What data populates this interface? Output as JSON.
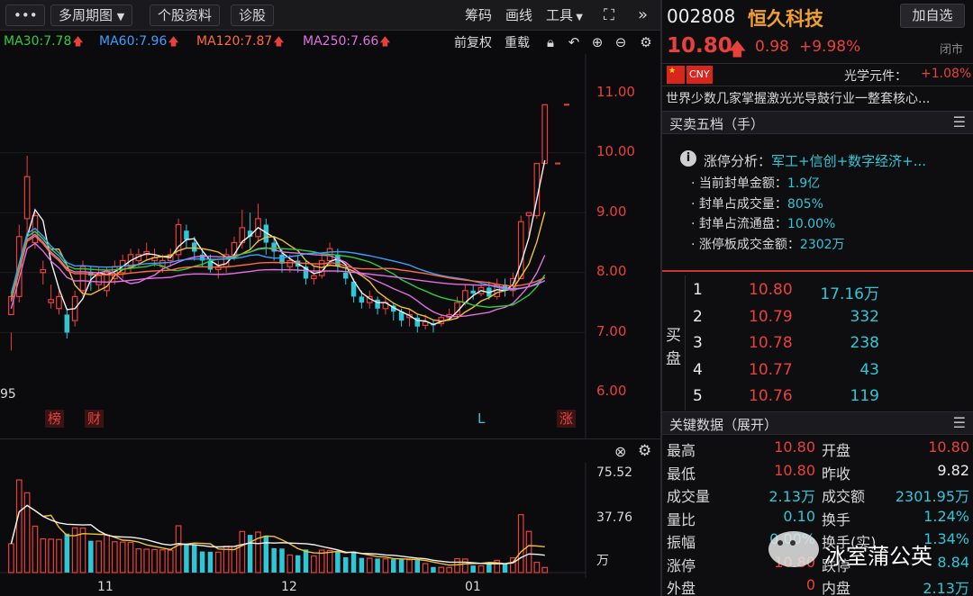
{
  "toolbar": {
    "more": "•••",
    "period": "多周期图",
    "stock_info": "个股资料",
    "diagnose": "诊股",
    "chips": "筹码",
    "draw": "画线",
    "tools": "工具",
    "collapse": "»"
  },
  "ma": {
    "ma30": "MA30:7.78",
    "ma60": "MA60:7.96",
    "ma120": "MA120:7.87",
    "ma250": "MA250:7.66",
    "adjust": "前复权",
    "overlay": "重载",
    "colors": {
      "ma30": "#2ecc40",
      "ma60": "#3aa0ff",
      "ma120": "#ff6a3d",
      "ma250": "#e070e0"
    }
  },
  "chart": {
    "y_ticks": [
      "11.00",
      "10.00",
      "9.00",
      "8.00",
      "7.00",
      "6.00"
    ],
    "corner_label": "95",
    "markers": [
      "榜",
      "财",
      "L",
      "涨"
    ],
    "vol_ticks": [
      "75.52",
      "37.76",
      "万"
    ],
    "x_ticks": [
      "11",
      "12",
      "01"
    ]
  },
  "chart_data": {
    "type": "bar",
    "title": "",
    "ylim": [
      6.0,
      11.0
    ],
    "y_ticks": [
      6.0,
      7.0,
      8.0,
      9.0,
      10.0,
      11.0
    ],
    "x_ticks": [
      "11",
      "12",
      "01"
    ],
    "candles": [
      [
        7.3,
        7.6,
        7.0,
        6.7
      ],
      [
        7.6,
        8.6,
        8.8,
        7.5
      ],
      [
        8.9,
        9.6,
        9.95,
        8.6
      ],
      [
        8.5,
        8.95,
        9.0,
        8.4
      ],
      [
        8.0,
        8.05,
        8.2,
        7.8
      ],
      [
        7.5,
        7.55,
        7.8,
        7.4
      ],
      [
        7.4,
        7.6,
        7.7,
        7.3
      ],
      [
        7.3,
        7.0,
        7.4,
        6.9
      ],
      [
        7.2,
        7.6,
        7.7,
        7.1
      ],
      [
        7.7,
        8.1,
        8.2,
        7.6
      ],
      [
        8.0,
        7.95,
        8.1,
        7.7
      ],
      [
        7.8,
        7.95,
        8.1,
        7.7
      ],
      [
        7.7,
        8.0,
        8.1,
        7.6
      ],
      [
        7.9,
        8.1,
        8.2,
        7.8
      ],
      [
        8.0,
        8.2,
        8.3,
        7.9
      ],
      [
        8.1,
        8.3,
        8.4,
        8.0
      ],
      [
        8.2,
        8.3,
        8.4,
        8.1
      ],
      [
        8.3,
        8.35,
        8.5,
        8.2
      ],
      [
        8.2,
        8.25,
        8.4,
        8.1
      ],
      [
        8.1,
        8.2,
        8.3,
        8.0
      ],
      [
        8.2,
        8.3,
        8.4,
        8.1
      ],
      [
        8.3,
        8.8,
        8.9,
        8.2
      ],
      [
        8.7,
        8.55,
        8.8,
        8.4
      ],
      [
        8.5,
        8.35,
        8.6,
        8.2
      ],
      [
        8.3,
        8.2,
        8.4,
        8.1
      ],
      [
        8.2,
        8.05,
        8.3,
        8.0
      ],
      [
        8.05,
        8.1,
        8.2,
        7.9
      ],
      [
        8.1,
        8.3,
        8.4,
        8.0
      ],
      [
        8.3,
        8.5,
        8.6,
        8.2
      ],
      [
        8.5,
        8.75,
        9.05,
        8.4
      ],
      [
        8.7,
        8.6,
        9.0,
        8.4
      ],
      [
        8.6,
        8.9,
        9.15,
        8.5
      ],
      [
        8.8,
        8.5,
        8.9,
        8.3
      ],
      [
        8.5,
        8.35,
        8.6,
        8.2
      ],
      [
        8.3,
        8.15,
        8.4,
        8.0
      ],
      [
        8.1,
        8.2,
        8.3,
        8.0
      ],
      [
        8.2,
        8.1,
        8.3,
        8.0
      ],
      [
        8.1,
        7.9,
        8.2,
        7.8
      ],
      [
        7.9,
        7.95,
        8.1,
        7.8
      ],
      [
        7.95,
        8.2,
        8.3,
        7.9
      ],
      [
        8.2,
        8.4,
        8.5,
        8.1
      ],
      [
        8.3,
        8.1,
        8.4,
        8.0
      ],
      [
        8.0,
        7.9,
        8.1,
        7.8
      ],
      [
        7.85,
        7.6,
        7.9,
        7.5
      ],
      [
        7.6,
        7.5,
        7.7,
        7.4
      ],
      [
        7.5,
        7.6,
        7.7,
        7.4
      ],
      [
        7.55,
        7.4,
        7.6,
        7.3
      ],
      [
        7.4,
        7.5,
        7.6,
        7.3
      ],
      [
        7.45,
        7.35,
        7.5,
        7.2
      ],
      [
        7.35,
        7.2,
        7.4,
        7.1
      ],
      [
        7.25,
        7.3,
        7.4,
        7.1
      ],
      [
        7.25,
        7.1,
        7.3,
        7.0
      ],
      [
        7.12,
        7.18,
        7.3,
        7.05
      ],
      [
        7.15,
        7.12,
        7.2,
        7.0
      ],
      [
        7.15,
        7.25,
        7.3,
        7.1
      ],
      [
        7.25,
        7.3,
        7.4,
        7.2
      ],
      [
        7.3,
        7.5,
        7.6,
        7.25
      ],
      [
        7.5,
        7.7,
        7.8,
        7.45
      ],
      [
        7.7,
        7.65,
        7.8,
        7.55
      ],
      [
        7.65,
        7.75,
        7.85,
        7.6
      ],
      [
        7.75,
        7.6,
        7.85,
        7.55
      ],
      [
        7.6,
        7.8,
        7.9,
        7.55
      ],
      [
        7.8,
        7.7,
        7.9,
        7.6
      ],
      [
        7.7,
        7.9,
        8.0,
        7.6
      ],
      [
        7.9,
        8.85,
        8.95,
        7.9
      ],
      [
        8.95,
        9.0,
        9.0,
        8.6
      ],
      [
        8.95,
        9.82,
        9.82,
        8.9
      ],
      [
        9.82,
        10.8,
        10.8,
        9.9
      ]
    ],
    "volume_ylim": [
      0,
      75.52
    ],
    "volume_unit": "万"
  },
  "stock": {
    "code": "002808",
    "name": "恒久科技",
    "add_watch": "加自选",
    "price": "10.80",
    "change": "0.98",
    "pct": "+9.98%",
    "status": "闭市",
    "currency": "CNY",
    "sector": "光学元件：",
    "sector_pct": "+1.08%",
    "desc": "世界少数几家掌握激光光导鼓行业一整套核心..."
  },
  "orderbook": {
    "title": "买卖五档（手）",
    "limit_title": "涨停分析：",
    "limit_tags": "军工+信创+数字经济+...",
    "limit_rows": [
      {
        "label": "当前封单金额：",
        "value": "1.9亿"
      },
      {
        "label": "封单占成交量：",
        "value": "805%"
      },
      {
        "label": "封单占流通盘：",
        "value": "10.00%"
      },
      {
        "label": "涨停板成交金额：",
        "value": "2302万"
      }
    ],
    "buy_label_1": "买",
    "buy_label_2": "盘",
    "bids": [
      {
        "level": "1",
        "price": "10.80",
        "vol": "17.16万"
      },
      {
        "level": "2",
        "price": "10.79",
        "vol": "332"
      },
      {
        "level": "3",
        "price": "10.78",
        "vol": "238"
      },
      {
        "level": "4",
        "price": "10.77",
        "vol": "43"
      },
      {
        "level": "5",
        "price": "10.76",
        "vol": "119"
      }
    ]
  },
  "keydata": {
    "title": "关键数据（展开）",
    "rows": [
      {
        "l1": "最高",
        "v1": "10.80",
        "c1": "red",
        "l2": "开盘",
        "v2": "10.80",
        "c2": "red"
      },
      {
        "l1": "最低",
        "v1": "10.80",
        "c1": "red",
        "l2": "昨收",
        "v2": "9.82",
        "c2": "white"
      },
      {
        "l1": "成交量",
        "v1": "2.13万",
        "c1": "cyan",
        "l2": "成交额",
        "v2": "2301.95万",
        "c2": "cyan"
      },
      {
        "l1": "量比",
        "v1": "0.10",
        "c1": "cyan",
        "l2": "换手",
        "v2": "1.24%",
        "c2": "cyan"
      },
      {
        "l1": "振幅",
        "v1": "0.00%",
        "c1": "cyan",
        "l2": "换手(实)",
        "v2": "1.34%",
        "c2": "cyan"
      },
      {
        "l1": "涨停",
        "v1": "10.80",
        "c1": "red",
        "l2": "跌停",
        "v2": "8.84",
        "c2": "cyan"
      },
      {
        "l1": "外盘",
        "v1": "0",
        "c1": "red",
        "l2": "内盘",
        "v2": "2.13万",
        "c2": "cyan"
      }
    ]
  },
  "watermark": "冰室蒲公英"
}
